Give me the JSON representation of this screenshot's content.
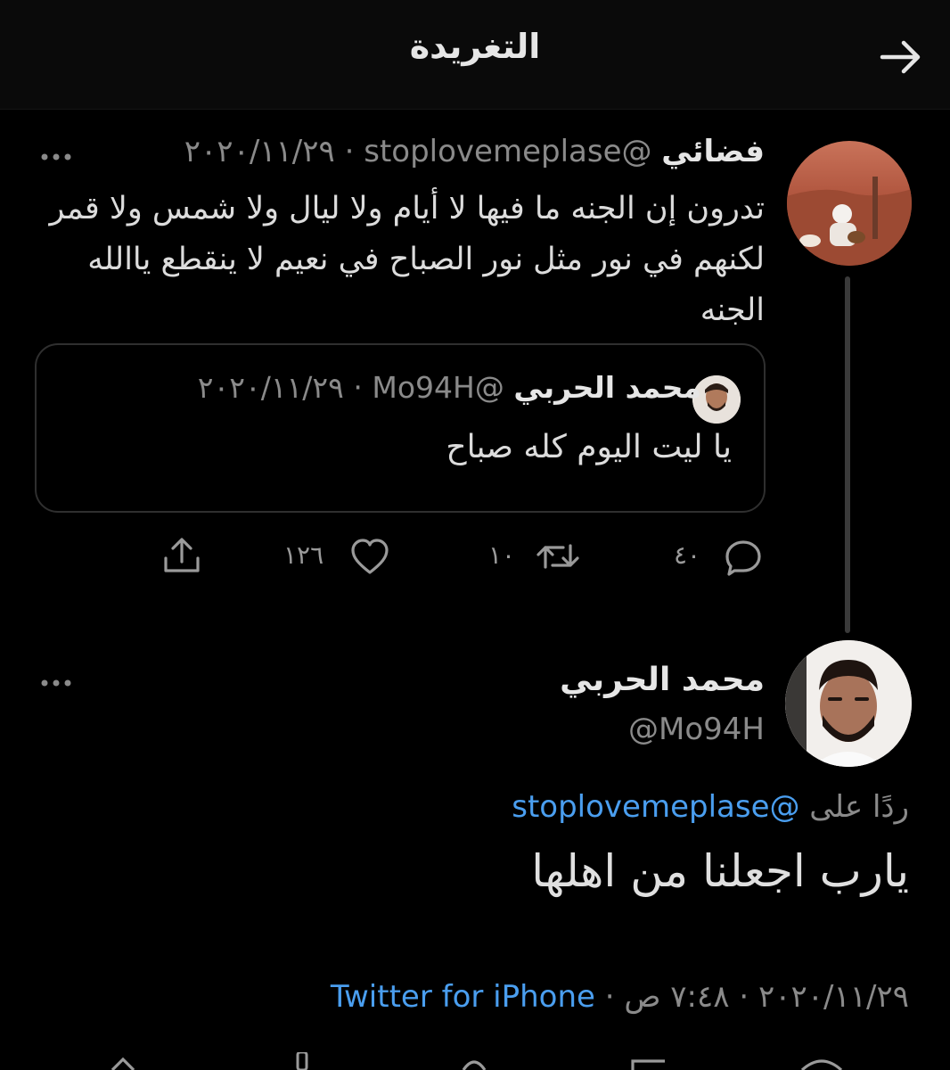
{
  "header": {
    "title": "التغريدة",
    "back_icon": "arrow-right-icon"
  },
  "tweet": {
    "display_name": "فضائي",
    "handle": "@stoplovemeplase",
    "separator": "·",
    "date": "٢٠٢٠/١١/٢٩",
    "text": "تدرون إن الجنه ما فيها لا أيام ولا ليال ولا شمس ولا قمر لكنهم في نور مثل نور الصباح في نعيم لا ينقطع ياالله الجنه",
    "quote": {
      "display_name": "محمد الحربي",
      "handle": "@Mo94H",
      "separator": "·",
      "date": "٢٠٢٠/١١/٢٩",
      "text": "يا ليت اليوم كله صباح"
    },
    "actions": {
      "replies": "٤٠",
      "retweets": "١٠",
      "likes": "١٢٦"
    }
  },
  "reply": {
    "display_name": "محمد الحربي",
    "handle": "@Mo94H",
    "replying_prefix": "ردًا على",
    "replying_handle": "@stoplovemeplase",
    "text": "يارب اجعلنا من اهلها",
    "date": "٢٠٢٠/١١/٢٩",
    "time": "٧:٤٨ ص",
    "separator": "·",
    "source": "Twitter for iPhone"
  },
  "colors": {
    "background": "#000000",
    "link": "#4a9eef",
    "muted": "#8a8a8a"
  }
}
